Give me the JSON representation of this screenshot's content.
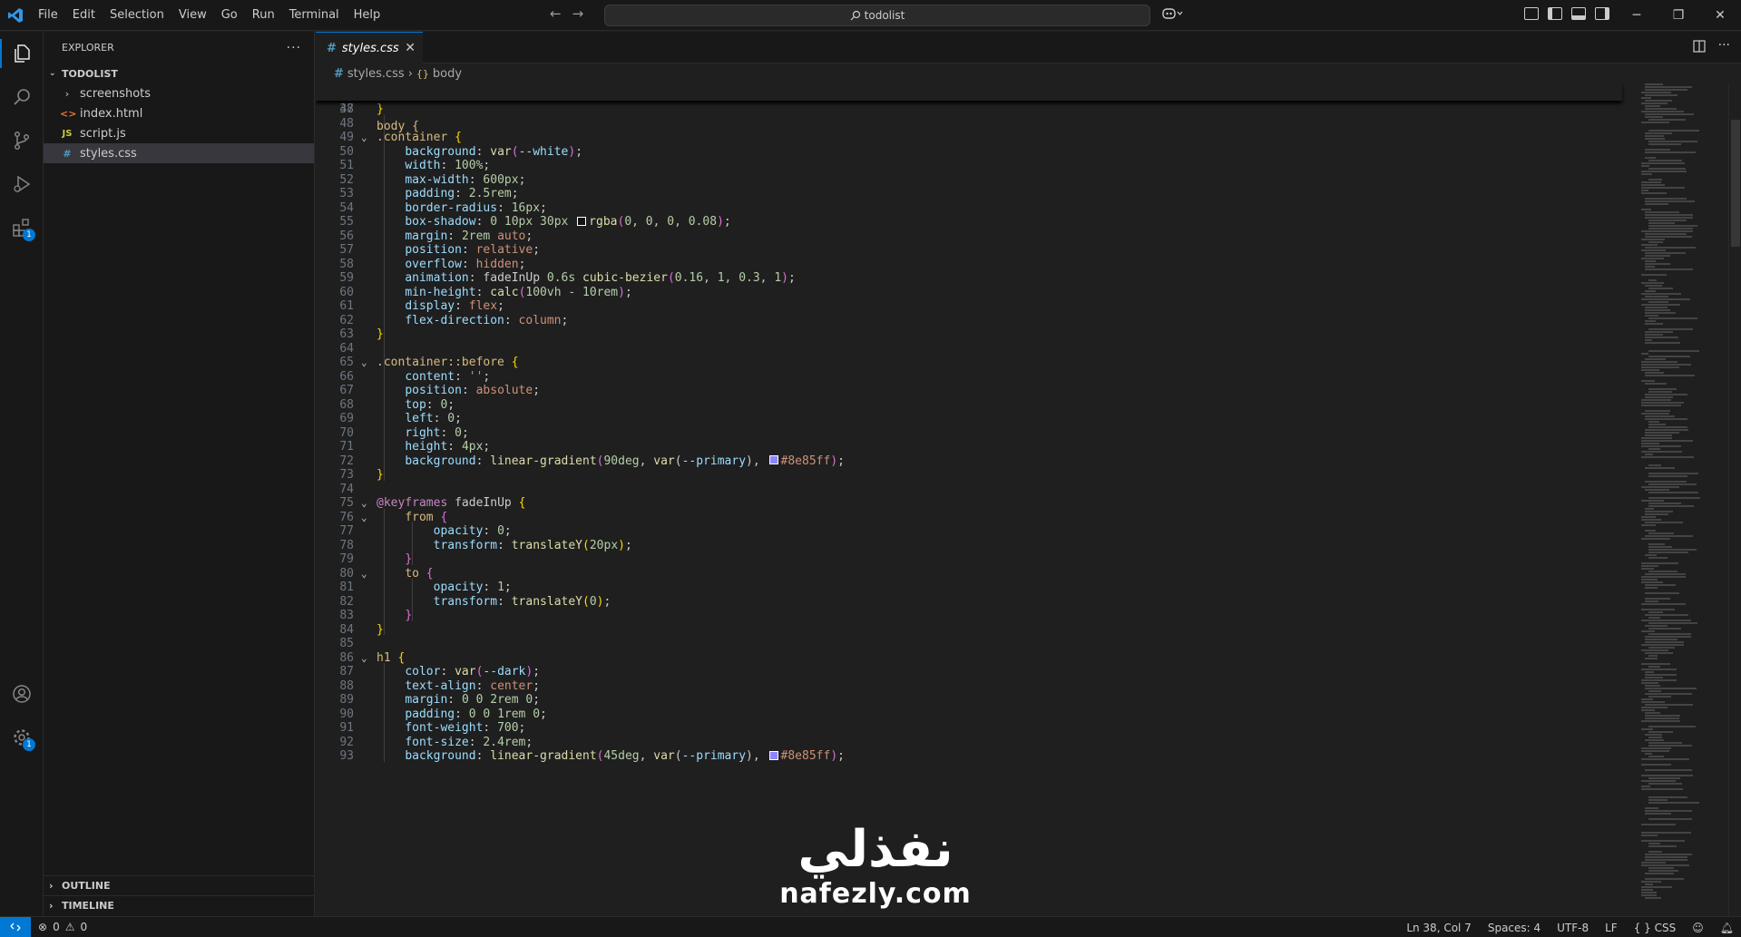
{
  "menu": [
    "File",
    "Edit",
    "Selection",
    "View",
    "Go",
    "Run",
    "Terminal",
    "Help"
  ],
  "search": {
    "text": "todolist"
  },
  "explorer": {
    "title": "EXPLORER",
    "folder": "TODOLIST",
    "files": [
      {
        "name": "screenshots",
        "kind": "folder"
      },
      {
        "name": "index.html",
        "kind": "html"
      },
      {
        "name": "script.js",
        "kind": "js"
      },
      {
        "name": "styles.css",
        "kind": "css"
      }
    ],
    "outline": "OUTLINE",
    "timeline": "TIMELINE"
  },
  "activity_badges": {
    "extensions": "1",
    "settings": "1"
  },
  "tab": {
    "label": "styles.css"
  },
  "breadcrumb": {
    "file": "styles.css",
    "symbol": "body"
  },
  "sticky": {
    "num": "38",
    "text": "body {"
  },
  "code_lines": [
    {
      "n": "47",
      "html": "<span class='t-br'>}</span>"
    },
    {
      "n": "48",
      "html": ""
    },
    {
      "n": "49",
      "fold": true,
      "html": "<span class='t-sel'>.container</span> <span class='t-br'>{</span>"
    },
    {
      "n": "50",
      "html": "    <span class='t-prop'>background</span>: <span class='t-fn'>var</span><span class='t-br2'>(</span><span class='t-prop'>--white</span><span class='t-br2'>)</span>;"
    },
    {
      "n": "51",
      "html": "    <span class='t-prop'>width</span>: <span class='t-num'>100%</span>;"
    },
    {
      "n": "52",
      "html": "    <span class='t-prop'>max-width</span>: <span class='t-num'>600px</span>;"
    },
    {
      "n": "53",
      "html": "    <span class='t-prop'>padding</span>: <span class='t-num'>2.5rem</span>;"
    },
    {
      "n": "54",
      "html": "    <span class='t-prop'>border-radius</span>: <span class='t-num'>16px</span>;"
    },
    {
      "n": "55",
      "html": "    <span class='t-prop'>box-shadow</span>: <span class='t-num'>0 10px 30px</span> <span class='swatch' style='background:#141414'></span><span class='t-fn'>rgba</span><span class='t-br2'>(</span><span class='t-num'>0, 0, 0, 0.08</span><span class='t-br2'>)</span>;"
    },
    {
      "n": "56",
      "html": "    <span class='t-prop'>margin</span>: <span class='t-num'>2rem</span> <span class='t-val'>auto</span>;"
    },
    {
      "n": "57",
      "html": "    <span class='t-prop'>position</span>: <span class='t-val'>relative</span>;"
    },
    {
      "n": "58",
      "html": "    <span class='t-prop'>overflow</span>: <span class='t-val'>hidden</span>;"
    },
    {
      "n": "59",
      "html": "    <span class='t-prop'>animation</span>: <span class='t-punc'>fadeInUp</span> <span class='t-num'>0.6s</span> <span class='t-fn'>cubic-bezier</span><span class='t-br2'>(</span><span class='t-num'>0.16, 1, 0.3, 1</span><span class='t-br2'>)</span>;"
    },
    {
      "n": "60",
      "html": "    <span class='t-prop'>min-height</span>: <span class='t-fn'>calc</span><span class='t-br2'>(</span><span class='t-num'>100vh - 10rem</span><span class='t-br2'>)</span>;"
    },
    {
      "n": "61",
      "html": "    <span class='t-prop'>display</span>: <span class='t-val'>flex</span>;"
    },
    {
      "n": "62",
      "html": "    <span class='t-prop'>flex-direction</span>: <span class='t-val'>column</span>;"
    },
    {
      "n": "63",
      "html": "<span class='t-br'>}</span>"
    },
    {
      "n": "64",
      "html": ""
    },
    {
      "n": "65",
      "fold": true,
      "html": "<span class='t-sel'>.container::before</span> <span class='t-br'>{</span>"
    },
    {
      "n": "66",
      "html": "    <span class='t-prop'>content</span>: <span class='t-val'>''</span>;"
    },
    {
      "n": "67",
      "html": "    <span class='t-prop'>position</span>: <span class='t-val'>absolute</span>;"
    },
    {
      "n": "68",
      "html": "    <span class='t-prop'>top</span>: <span class='t-num'>0</span>;"
    },
    {
      "n": "69",
      "html": "    <span class='t-prop'>left</span>: <span class='t-num'>0</span>;"
    },
    {
      "n": "70",
      "html": "    <span class='t-prop'>right</span>: <span class='t-num'>0</span>;"
    },
    {
      "n": "71",
      "html": "    <span class='t-prop'>height</span>: <span class='t-num'>4px</span>;"
    },
    {
      "n": "72",
      "html": "    <span class='t-prop'>background</span>: <span class='t-fn'>linear-gradient</span><span class='t-br2'>(</span><span class='t-num'>90deg</span>, <span class='t-fn'>var</span>(<span class='t-prop'>--primary</span>), <span class='swatch' style='background:#8e85ff'></span><span class='t-val'>#8e85ff</span><span class='t-br2'>)</span>;"
    },
    {
      "n": "73",
      "html": "<span class='t-br'>}</span>"
    },
    {
      "n": "74",
      "html": ""
    },
    {
      "n": "75",
      "fold": true,
      "html": "<span class='t-at'>@keyframes</span> <span class='t-punc'>fadeInUp</span> <span class='t-br'>{</span>"
    },
    {
      "n": "76",
      "fold": true,
      "html": "    <span class='t-sel'>from</span> <span class='t-br2'>{</span>"
    },
    {
      "n": "77",
      "html": "        <span class='t-prop'>opacity</span>: <span class='t-num'>0</span>;"
    },
    {
      "n": "78",
      "html": "        <span class='t-prop'>transform</span>: <span class='t-fn'>translateY</span><span class='t-br'>(</span><span class='t-num'>20px</span><span class='t-br'>)</span>;"
    },
    {
      "n": "79",
      "html": "    <span class='t-br2'>}</span>"
    },
    {
      "n": "80",
      "fold": true,
      "html": "    <span class='t-sel'>to</span> <span class='t-br2'>{</span>"
    },
    {
      "n": "81",
      "html": "        <span class='t-prop'>opacity</span>: <span class='t-num'>1</span>;"
    },
    {
      "n": "82",
      "html": "        <span class='t-prop'>transform</span>: <span class='t-fn'>translateY</span><span class='t-br'>(</span><span class='t-num'>0</span><span class='t-br'>)</span>;"
    },
    {
      "n": "83",
      "html": "    <span class='t-br2'>}</span>"
    },
    {
      "n": "84",
      "html": "<span class='t-br'>}</span>"
    },
    {
      "n": "85",
      "html": ""
    },
    {
      "n": "86",
      "fold": true,
      "html": "<span class='t-sel'>h1</span> <span class='t-br'>{</span>"
    },
    {
      "n": "87",
      "html": "    <span class='t-prop'>color</span>: <span class='t-fn'>var</span><span class='t-br2'>(</span><span class='t-prop'>--dark</span><span class='t-br2'>)</span>;"
    },
    {
      "n": "88",
      "html": "    <span class='t-prop'>text-align</span>: <span class='t-val'>center</span>;"
    },
    {
      "n": "89",
      "html": "    <span class='t-prop'>margin</span>: <span class='t-num'>0 0 2rem 0</span>;"
    },
    {
      "n": "90",
      "html": "    <span class='t-prop'>padding</span>: <span class='t-num'>0 0 1rem 0</span>;"
    },
    {
      "n": "91",
      "html": "    <span class='t-prop'>font-weight</span>: <span class='t-num'>700</span>;"
    },
    {
      "n": "92",
      "html": "    <span class='t-prop'>font-size</span>: <span class='t-num'>2.4rem</span>;"
    },
    {
      "n": "93",
      "html": "    <span class='t-prop'>background</span>: <span class='t-fn'>linear-gradient</span><span class='t-br2'>(</span><span class='t-num'>45deg</span>, <span class='t-fn'>var</span>(<span class='t-prop'>--primary</span>), <span class='swatch' style='background:#8e85ff'></span><span class='t-val'>#8e85ff</span><span class='t-br2'>)</span>;"
    }
  ],
  "watermark": {
    "arabic": "نفذلي",
    "latin": "nafezly.com"
  },
  "status": {
    "errors": "0",
    "warnings": "0",
    "position": "Ln 38, Col 7",
    "spaces": "Spaces: 4",
    "encoding": "UTF-8",
    "eol": "LF",
    "language": "CSS"
  },
  "colors": {
    "accent": "#0078d4",
    "editor_bg": "#1f1f1f",
    "chrome_bg": "#181818"
  }
}
